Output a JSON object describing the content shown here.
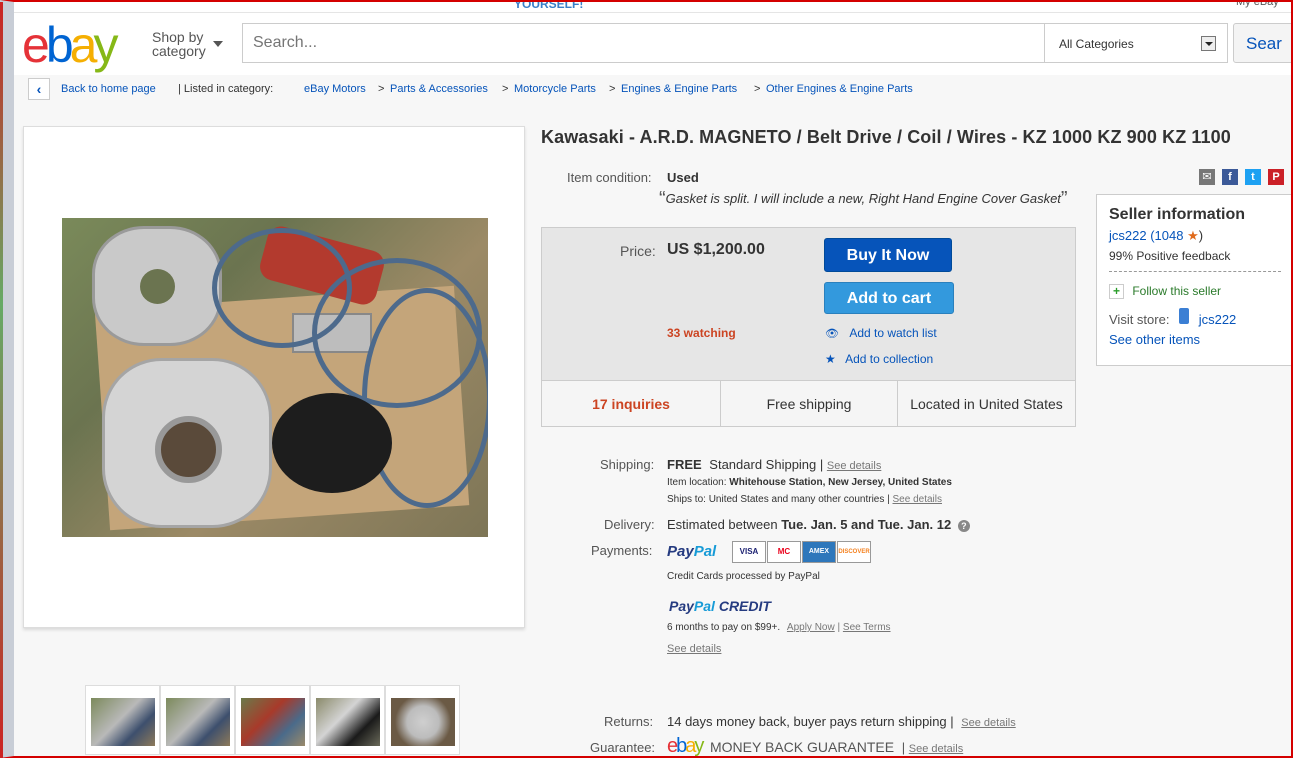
{
  "top": {
    "promo": "YOURSELF!",
    "myebay": "My eBay"
  },
  "header": {
    "logo": [
      "e",
      "b",
      "a",
      "y"
    ],
    "shop_by": "Shop by",
    "shop_by_2": "category",
    "search_placeholder": "Search...",
    "category": "All Categories",
    "search_button": "Sear"
  },
  "breadcrumb": {
    "back": "Back to home page",
    "listed": "| Listed in category:",
    "items": [
      "eBay Motors",
      "Parts & Accessories",
      "Motorcycle Parts",
      "Engines & Engine Parts",
      "Other Engines & Engine Parts"
    ],
    "sep": ">"
  },
  "item": {
    "title": "Kawasaki - A.R.D. MAGNETO / Belt Drive / Coil / Wires - KZ 1000 KZ 900 KZ 1100",
    "condition_label": "Item condition:",
    "condition_value": "Used",
    "condition_note": "Gasket is split. I will include a new, Right Hand Engine Cover Gasket",
    "price_label": "Price:",
    "price": "US $1,200.00",
    "buy_now": "Buy It Now",
    "add_to_cart": "Add to cart",
    "watching": "33 watching",
    "watch_list": "Add to watch list",
    "collection": "Add to collection",
    "inquiries": "17 inquiries",
    "free_shipping": "Free shipping",
    "location": "Located in United States"
  },
  "share": {
    "icons": [
      "email-icon",
      "facebook-icon",
      "twitter-icon",
      "pinterest-icon"
    ],
    "labels": [
      "✉",
      "f",
      "t",
      "P"
    ],
    "colors": [
      "#777777",
      "#3b5998",
      "#1da1f2",
      "#cb2027"
    ]
  },
  "seller": {
    "heading": "Seller information",
    "name": "jcs222",
    "score": "(1048",
    "score_end": ")",
    "positive": "99% Positive feedback",
    "follow": "Follow this seller",
    "visit_store": "Visit store:",
    "store_name": "jcs222",
    "other_items": "See other items"
  },
  "details": {
    "shipping_label": "Shipping:",
    "shipping_free": "FREE",
    "shipping_method": "Standard Shipping |",
    "see_details": "See details",
    "item_location_label": "Item location:",
    "item_location": "Whitehouse Station, New Jersey, United States",
    "ships_to_label": "Ships to:",
    "ships_to": "United States and many other countries |",
    "delivery_label": "Delivery:",
    "delivery_prefix": "Estimated between",
    "delivery_dates": "Tue. Jan. 5 and Tue. Jan. 12",
    "payments_label": "Payments:",
    "paypal_a": "Pay",
    "paypal_b": "Pal",
    "cards": [
      "VISA",
      "MC",
      "AMEX",
      "DISCOVER"
    ],
    "card_colors": [
      "#1a1f71",
      "#eb001b",
      "#2e77bb",
      "#f58220"
    ],
    "credit_cards_note": "Credit Cards processed by PayPal",
    "paypal_credit": "CREDIT",
    "credit_terms": "6 months to pay on $99+.",
    "apply_now": "Apply Now",
    "see_terms": "See Terms",
    "returns_label": "Returns:",
    "returns": "14 days money back, buyer pays return shipping |",
    "guarantee_label": "Guarantee:",
    "guarantee": "MONEY BACK GUARANTEE",
    "guarantee_sep": "|"
  }
}
